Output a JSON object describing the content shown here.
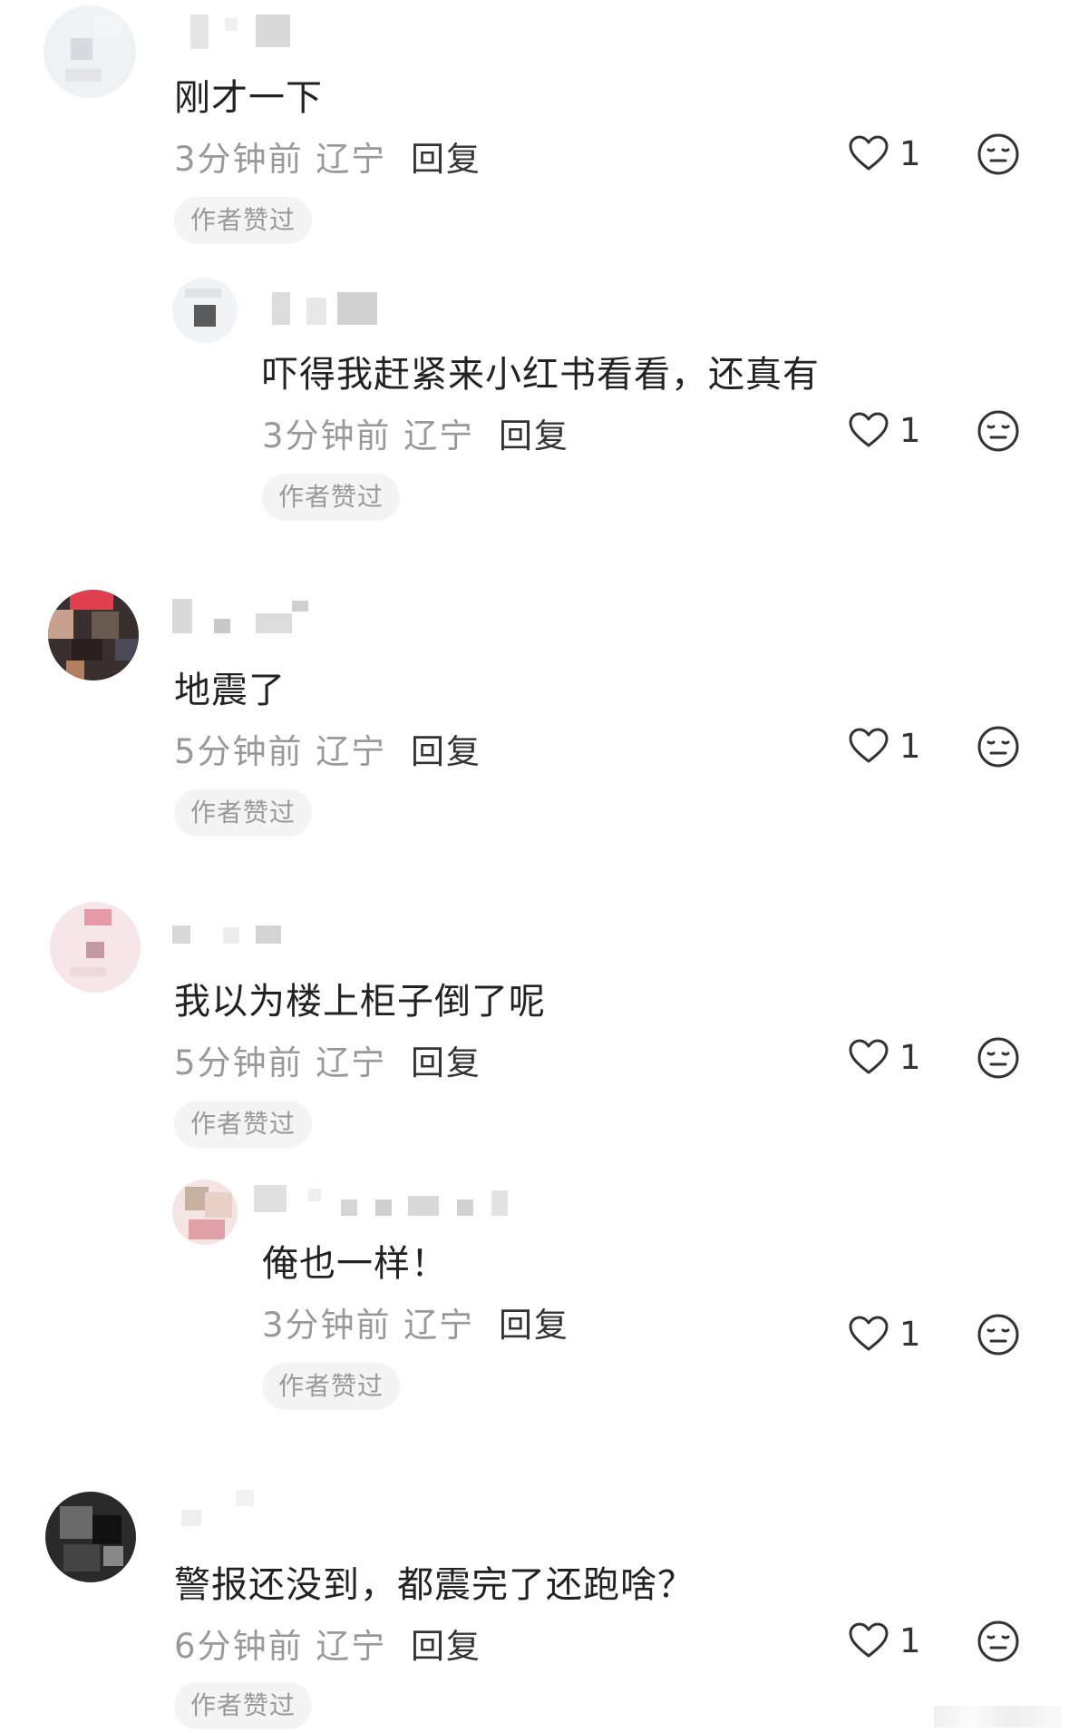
{
  "comments": [
    {
      "content": "刚才一下",
      "meta": "3分钟前 辽宁",
      "reply": "回复",
      "likes": "1",
      "badge": "作者赞过"
    },
    {
      "content": "吓得我赶紧来小红书看看，还真有",
      "meta": "3分钟前 辽宁",
      "reply": "回复",
      "likes": "1",
      "badge": "作者赞过"
    },
    {
      "content": "地震了",
      "meta": "5分钟前 辽宁",
      "reply": "回复",
      "likes": "1",
      "badge": "作者赞过"
    },
    {
      "content": "我以为楼上柜子倒了呢",
      "meta": "5分钟前 辽宁",
      "reply": "回复",
      "likes": "1",
      "badge": "作者赞过"
    },
    {
      "content": "俺也一样！",
      "meta": "3分钟前 辽宁",
      "reply": "回复",
      "likes": "1",
      "badge": "作者赞过"
    },
    {
      "content": "警报还没到，都震完了还跑啥？",
      "meta": "6分钟前 辽宁",
      "reply": "回复",
      "likes": "1",
      "badge": "作者赞过"
    }
  ],
  "icons": {
    "like": "heart-outline-icon",
    "react": "expressionless-face-icon"
  },
  "colors": {
    "text": "#222222",
    "meta": "#999999",
    "badge_bg": "#f4f4f4"
  }
}
